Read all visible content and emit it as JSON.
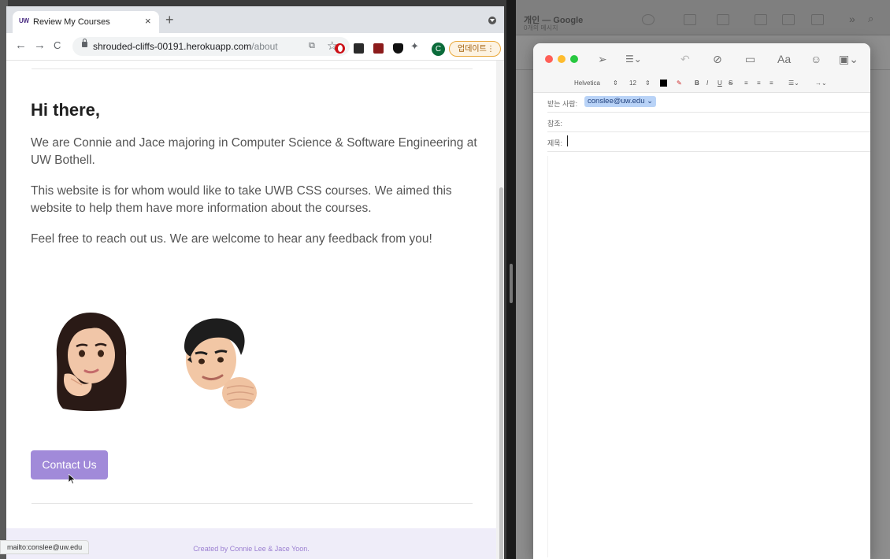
{
  "background_app": {
    "title": "개인 — Google",
    "subtitle": "0개의 메시지"
  },
  "browser": {
    "tab_title": "Review My Courses",
    "tab_favicon": "UW",
    "new_tab_glyph": "+",
    "close_glyph": "×",
    "url_host": "shrouded-cliffs-00191.herokuapp.com",
    "url_path": "/about",
    "profile_initial": "C",
    "update_label": "업데이트",
    "nav": {
      "back": "←",
      "forward": "→",
      "reload": "C"
    }
  },
  "page": {
    "heading": "Hi there,",
    "paragraph_1": "We are Connie and Jace majoring in Computer Science & Software Engineering at UW Bothell.",
    "paragraph_2": "This website is for whom would like to take UWB CSS courses. We aimed this website to help them have more information about the courses.",
    "paragraph_3": "Feel free to reach out us. We are welcome to hear any feedback from you!",
    "contact_button": "Contact Us",
    "footer_credit": "Created by Connie Lee & Jace Yoon.",
    "status_link": "mailto:conslee@uw.edu"
  },
  "compose": {
    "font_name": "Helvetica",
    "font_size": "12",
    "font_button": "Aa",
    "to_label": "받는 사람:",
    "to_recipient": "conslee@uw.edu",
    "cc_label": "참조:",
    "subject_label": "제목:",
    "format_marks": {
      "bold": "B",
      "italic": "I",
      "underline": "U",
      "strike": "S"
    }
  },
  "colors": {
    "button_purple": "#a18ad9",
    "footer_bg": "#efedf9",
    "recipient_chip": "#b9d3f7",
    "update_orange": "#e9a83b"
  }
}
